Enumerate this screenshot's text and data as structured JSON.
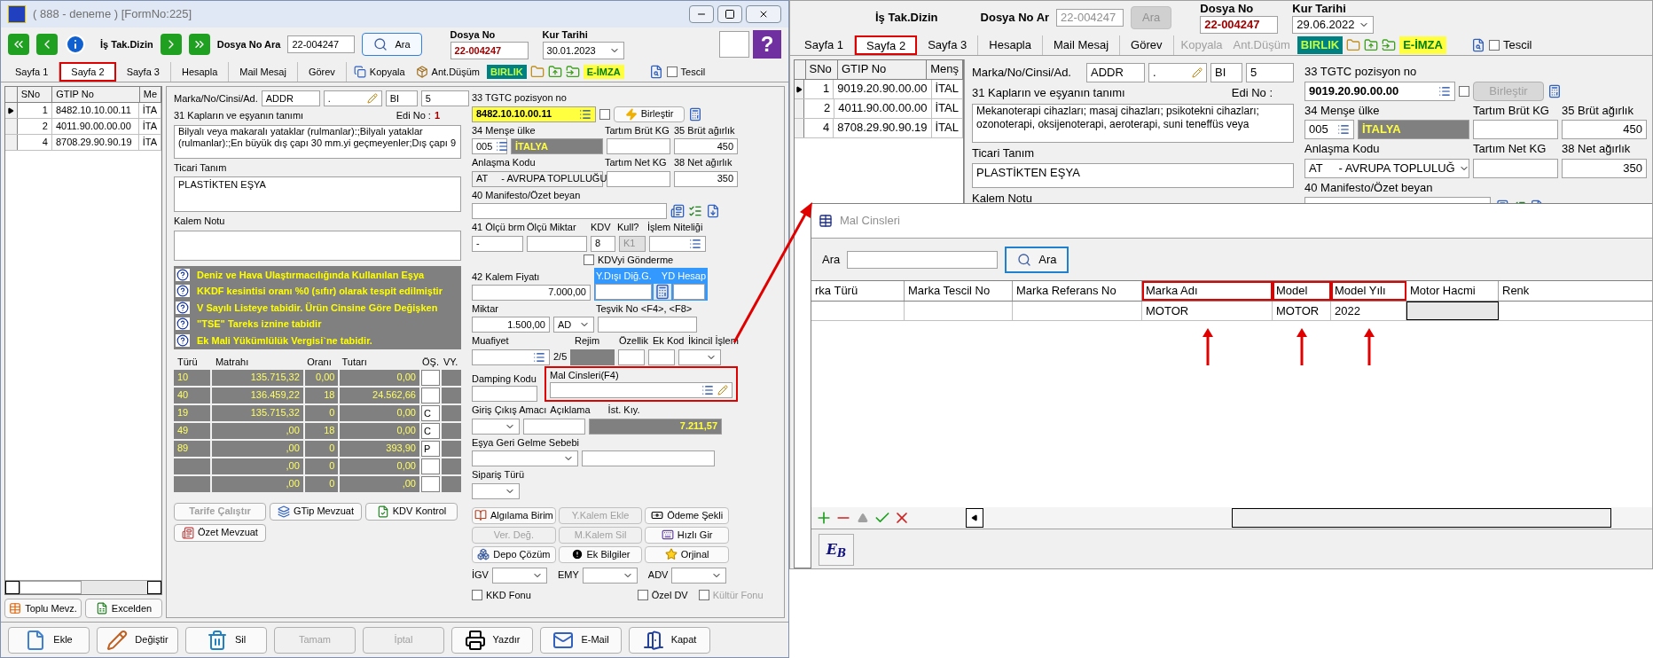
{
  "left_window": {
    "title": "( 888 - deneme ) [FormNo:225]",
    "header": {
      "nav_label": "İş Tak.Dizin",
      "search_label": "Dosya No Ara",
      "search_value": "22-004247",
      "search_disabled": false,
      "search_button": "Ara",
      "dosya_no_label": "Dosya No",
      "dosya_no": "22-004247",
      "kur_tarihi_label": "Kur Tarihi",
      "kur_tarihi": "30.01.2023",
      "help": "?"
    },
    "tabs": [
      {
        "label": "Sayfa 1",
        "selected": false,
        "highlighted": false
      },
      {
        "label": "Sayfa 2",
        "selected": true,
        "highlighted": true
      },
      {
        "label": "Sayfa 3",
        "selected": false,
        "highlighted": false
      },
      {
        "label": "Hesapla",
        "selected": false,
        "highlighted": false
      },
      {
        "label": "Mail Mesaj",
        "selected": false,
        "highlighted": false
      },
      {
        "label": "Görev",
        "selected": false,
        "highlighted": false
      }
    ],
    "tools": {
      "kopyala": {
        "label": "Kopyala",
        "disabled": false
      },
      "ant_dusum": {
        "label": "Ant.Düşüm",
        "disabled": false
      },
      "birlik": "BIRLIK",
      "e_imza": "E-İMZA",
      "tescil": {
        "label": "Tescil",
        "checked": false
      }
    },
    "grid": {
      "columns": [
        "SNo",
        "GTIP No",
        "Me"
      ],
      "rows": [
        {
          "cells": [
            "1",
            "8482.10.10.00.11",
            "İTA"
          ],
          "selected": true
        },
        {
          "cells": [
            "2",
            "4011.90.00.00.00",
            "İTA"
          ],
          "selected": false
        },
        {
          "cells": [
            "4",
            "8708.29.90.90.19",
            "İTA"
          ],
          "selected": false
        }
      ],
      "buttons": [
        "Toplu Mevz.",
        "Excelden"
      ]
    },
    "form": {
      "marka": {
        "label": "Marka/No/Cinsi/Ad.",
        "values": [
          "ADDR",
          ".",
          "BI",
          "5"
        ]
      },
      "tanim": {
        "label": "31 Kapların ve eşyanın tanımı",
        "edi_label": "Edi No :",
        "edi_value": "1",
        "text": "Bilyalı veya makaralı yataklar (rulmanlar):;Bilyalı yataklar (rulmanlar):;En büyük dış çapı 30 mm.yi geçmeyenler;Dış çapı 9"
      },
      "ticari": {
        "label": "Ticari Tanım",
        "text": "PLASTİKTEN EŞYA"
      },
      "kalem_notu": {
        "label": "Kalem Notu"
      },
      "notices": [
        "Deniz ve Hava Ulaştırmacılığında Kullanılan Eşya",
        "KKDF kesintisi oranı %0 (sıfır) olarak tespit edilmiştir",
        "V Sayılı Listeye tabidir. Ürün Cinsine Göre Değişken",
        "\"TSE\" Tareks iznine tabidir",
        "Ek Mali Yükümlülük Vergisi`ne tabidir."
      ],
      "tax_table": {
        "columns": [
          "Türü",
          "Matrahı",
          "Oranı",
          "Tutarı",
          "ÖŞ.",
          "VY."
        ],
        "rows": [
          {
            "turu": "10",
            "matrah": "135.715,32",
            "oran": "0,00",
            "tutar": "0,00"
          },
          {
            "turu": "40",
            "matrah": "136.459,22",
            "oran": "18",
            "tutar": "24.562,66"
          },
          {
            "turu": "19",
            "matrah": "135.715,32",
            "oran": "0",
            "tutar": "0,00",
            "os": "C"
          },
          {
            "turu": "49",
            "matrah": ",00",
            "oran": "18",
            "tutar": "0,00",
            "os": "C"
          },
          {
            "turu": "89",
            "matrah": ",00",
            "oran": "0",
            "tutar": "393,90",
            "os": "P"
          },
          {
            "matrah": ",00",
            "oran": "0",
            "tutar": "0,00"
          },
          {
            "matrah": ",00",
            "oran": "0",
            "tutar": ",00"
          }
        ]
      },
      "mevzuat_buttons": [
        {
          "label": "Tarife Çalıştır",
          "disabled": true
        },
        {
          "label": "GTip Mevzuat",
          "disabled": false
        },
        {
          "label": "KDV Kontrol",
          "disabled": false
        },
        {
          "label": "Özet Mevzuat",
          "disabled": false
        }
      ]
    },
    "side": {
      "tgtc": {
        "label": "33 TGTC pozisyon no",
        "value": "8482.10.10.00.11",
        "focused": true,
        "checked": false,
        "button": "Birleştir",
        "button_disabled": false
      },
      "mense": {
        "label": "34 Menşe ülke",
        "code": "005",
        "country": "İTALYA"
      },
      "brut_kg": "Tartım Brüt KG",
      "brut": {
        "label": "35 Brüt ağırlık",
        "value": "450"
      },
      "anlasma": {
        "label": "Anlaşma Kodu",
        "value": "AT     - AVRUPA TOPLULUĞU",
        "disabled": true
      },
      "net_kg": "Tartım Net KG",
      "net": {
        "label": "38 Net ağırlık",
        "value": "350"
      },
      "manifesto": "40 Manifesto/Özet beyan",
      "olcu": {
        "labels": [
          "41 Ölçü brm",
          "Ölçü Miktar",
          "KDV",
          "Kull?",
          "İşlem Niteliği"
        ],
        "brm": "-",
        "kdv": "8",
        "kull": "K1"
      },
      "kdvyi": {
        "label": "KDVyi Gönderme",
        "checked": false
      },
      "kalem_fiyati": {
        "label": "42 Kalem Fiyatı",
        "value": "7.000,00"
      },
      "ydisi": "Y.Dışı Diğ.G.",
      "yd_hesap": "YD Hesap",
      "miktar": {
        "label": "Miktar",
        "value": "1.500,00",
        "unit": "AD"
      },
      "tesvik": "Teşvik No <F4>, <F8>",
      "muafiyet": {
        "label": "Muafiyet",
        "count": "2/5"
      },
      "rejim": "Rejim",
      "ozellik": "Özellik",
      "ek_kod": "Ek Kod",
      "ikincil": "İkincil İşlem",
      "damping": "Damping Kodu",
      "mal_cinsleri": {
        "label": "Mal Cinsleri(F4)",
        "highlighted": true
      },
      "giris": "Giriş Çıkış Amacı",
      "aciklama": "Açıklama",
      "ist_kiy": {
        "label": "İst. Kıy.",
        "value": "7.211,57"
      },
      "esya_geri": "Eşya Geri Gelme Sebebi",
      "siparis": "Sipariş Türü",
      "actions": [
        {
          "label": "Algılama Birim",
          "disabled": false
        },
        {
          "label": "Y.Kalem Ekle",
          "disabled": true
        },
        {
          "label": "Ödeme Şekli",
          "disabled": false
        },
        {
          "label": "Ver. Değ.",
          "disabled": true
        },
        {
          "label": "M.Kalem Sil",
          "disabled": true
        },
        {
          "label": "Hızlı Gir",
          "disabled": false
        },
        {
          "label": "Depo Çözüm",
          "disabled": false
        },
        {
          "label": "Ek Bilgiler",
          "disabled": false
        },
        {
          "label": "Orjinal",
          "disabled": false
        }
      ],
      "dropdowns": [
        "İGV",
        "EMY",
        "ADV"
      ],
      "checks": [
        {
          "label": "KKD Fonu",
          "checked": false,
          "disabled": false
        },
        {
          "label": "Özel DV",
          "checked": false,
          "disabled": false
        },
        {
          "label": "Kültür Fonu",
          "checked": false,
          "disabled": true
        }
      ]
    },
    "bottom_buttons": [
      {
        "label": "Ekle",
        "disabled": false
      },
      {
        "label": "Değiştir",
        "disabled": false
      },
      {
        "label": "Sil",
        "disabled": false
      },
      {
        "label": "Tamam",
        "disabled": true
      },
      {
        "label": "İptal",
        "disabled": true
      },
      {
        "label": "Yazdır",
        "disabled": false
      },
      {
        "label": "E-Mail",
        "disabled": false
      },
      {
        "label": "Kapat",
        "disabled": false
      }
    ]
  },
  "right_window": {
    "header": {
      "nav_label": "İş Tak.Dizin",
      "search_label": "Dosya No Ar",
      "search_value": "22-004247",
      "search_disabled": true,
      "search_button": "Ara",
      "dosya_no_label": "Dosya No",
      "dosya_no": "22-004247",
      "kur_tarihi_label": "Kur Tarihi",
      "kur_tarihi": "29.06.2022"
    },
    "tabs": [
      {
        "label": "Sayfa 1",
        "selected": false,
        "highlighted": false
      },
      {
        "label": "Sayfa 2",
        "selected": true,
        "highlighted": true
      },
      {
        "label": "Sayfa 3",
        "selected": false,
        "highlighted": false
      },
      {
        "label": "Hesapla",
        "selected": false,
        "highlighted": false
      },
      {
        "label": "Mail Mesaj",
        "selected": false,
        "highlighted": false
      },
      {
        "label": "Görev",
        "selected": false,
        "highlighted": false
      }
    ],
    "tools": {
      "kopyala": {
        "label": "Kopyala",
        "disabled": true
      },
      "ant_dusum": {
        "label": "Ant.Düşüm",
        "disabled": true
      },
      "birlik": "BIRLIK",
      "e_imza": "E-İMZA",
      "tescil": {
        "label": "Tescil",
        "checked": false
      }
    },
    "grid": {
      "columns": [
        "SNo",
        "GTIP No",
        "Menş"
      ],
      "rows": [
        {
          "cells": [
            "1",
            "9019.20.90.00.00",
            "İTAL"
          ],
          "selected": true
        },
        {
          "cells": [
            "2",
            "4011.90.00.00.00",
            "İTAL"
          ],
          "selected": false
        },
        {
          "cells": [
            "4",
            "8708.29.90.90.19",
            "İTAL"
          ],
          "selected": false
        }
      ]
    },
    "form": {
      "marka": {
        "label": "Marka/No/Cinsi/Ad.",
        "values": [
          "ADDR",
          ".",
          "BI",
          "5"
        ]
      },
      "tanim": {
        "label": "31 Kapların ve eşyanın tanımı",
        "edi_label": "Edi No :",
        "text": "Mekanoterapi cihazları; masaj cihazları; psikotekni cihazları; ozonoterapi, oksijenoterapi, aeroterapi, suni teneffüs veya"
      },
      "ticari": {
        "label": "Ticari Tanım",
        "text": "PLASTİKTEN EŞYA"
      },
      "kalem_notu": {
        "label": "Kalem Notu"
      }
    },
    "side": {
      "tgtc": {
        "label": "33 TGTC pozisyon no",
        "value": "9019.20.90.00.00",
        "focused": false,
        "checked": false,
        "button": "Birleştir",
        "button_disabled": true
      },
      "mense": {
        "label": "34 Menşe ülke",
        "code": "005",
        "country": "İTALYA"
      },
      "brut_kg": "Tartım Brüt KG",
      "brut": {
        "label": "35 Brüt ağırlık",
        "value": "450"
      },
      "anlasma": {
        "label": "Anlaşma Kodu",
        "value": "AT     - AVRUPA TOPLULUĞ",
        "disabled": false
      },
      "net_kg": "Tartım Net KG",
      "net": {
        "label": "38 Net ağırlık",
        "value": "350"
      },
      "manifesto": "40 Manifesto/Özet beyan"
    }
  },
  "dialog": {
    "title": "Mal Cinsleri",
    "search_label": "Ara",
    "search_button": "Ara",
    "columns": [
      {
        "label": "rka Türü",
        "highlighted": false
      },
      {
        "label": "Marka Tescil No",
        "highlighted": false
      },
      {
        "label": "Marka Referans No",
        "highlighted": false
      },
      {
        "label": "Marka Adı",
        "highlighted": true
      },
      {
        "label": "Model",
        "highlighted": true
      },
      {
        "label": "Model Yılı",
        "highlighted": true
      },
      {
        "label": "Motor Hacmi",
        "highlighted": false
      },
      {
        "label": "Renk",
        "highlighted": false
      }
    ],
    "rows": [
      [
        null,
        null,
        null,
        "MOTOR",
        "MOTOR",
        "2022",
        null,
        null
      ]
    ],
    "footer_button": "E$_{B}$"
  }
}
